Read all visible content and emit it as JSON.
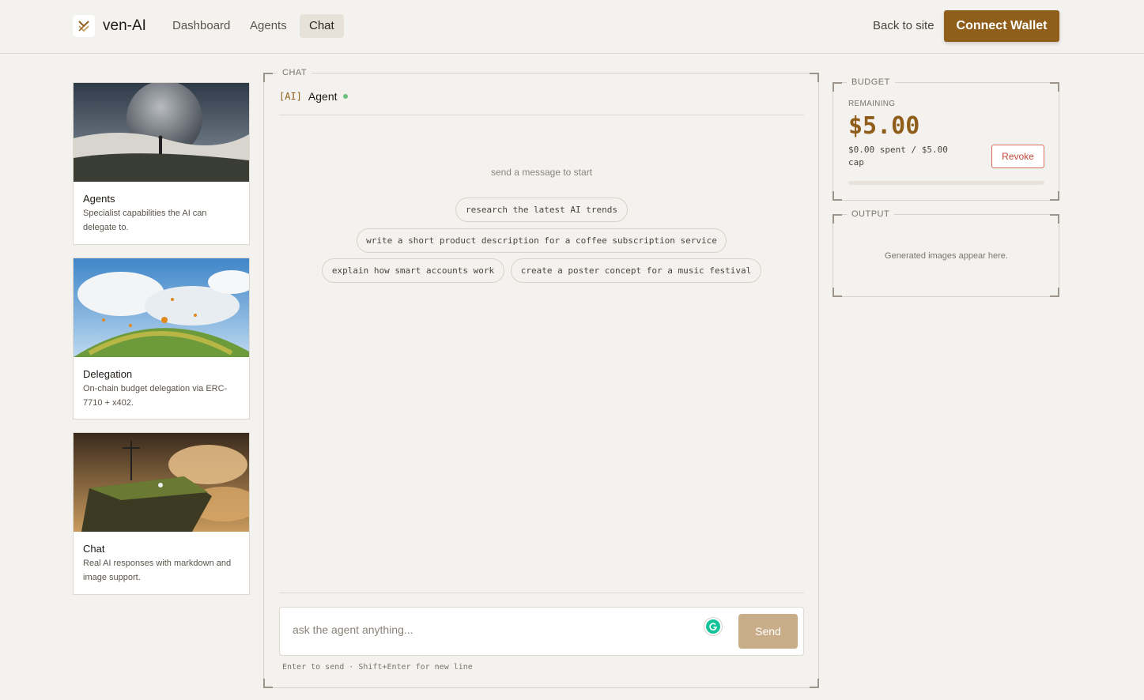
{
  "brand": {
    "name": "ven-AI",
    "logo_icon": "ven-logo-icon"
  },
  "nav": {
    "items": [
      {
        "label": "Dashboard"
      },
      {
        "label": "Agents"
      },
      {
        "label": "Chat"
      }
    ],
    "active": "Chat"
  },
  "header": {
    "back_label": "Back to site",
    "connect_label": "Connect Wallet"
  },
  "cards": [
    {
      "title": "Agents",
      "description": "Specialist capabilities the AI can delegate to.",
      "image": "moon-desert-image"
    },
    {
      "title": "Delegation",
      "description": "On-chain budget delegation via ERC-7710 + x402.",
      "image": "butterfly-hill-image"
    },
    {
      "title": "Chat",
      "description": "Real AI responses with markdown and image support.",
      "image": "cliff-clouds-image"
    }
  ],
  "chat": {
    "section_label": "CHAT",
    "ai_tag": "[AI]",
    "agent_name": "Agent",
    "empty_hint": "send a message to start",
    "suggestions": [
      "research the latest AI trends",
      "write a short product description for a coffee subscription service",
      "explain how smart accounts work",
      "create a poster concept for a music festival"
    ],
    "input_placeholder": "ask the agent anything...",
    "send_label": "Send",
    "hint": "Enter to send · Shift+Enter for new line"
  },
  "budget": {
    "section_label": "BUDGET",
    "remaining_label": "REMAINING",
    "remaining": "$5.00",
    "spent_text": "$0.00 spent / $5.00 cap",
    "spent_fraction": 0,
    "revoke_label": "Revoke"
  },
  "output": {
    "section_label": "OUTPUT",
    "empty_text": "Generated images appear here."
  },
  "colors": {
    "accent": "#8f5e1b",
    "background": "#f4f2ee",
    "revoke": "#c5483a",
    "status": "#6cc07c"
  }
}
